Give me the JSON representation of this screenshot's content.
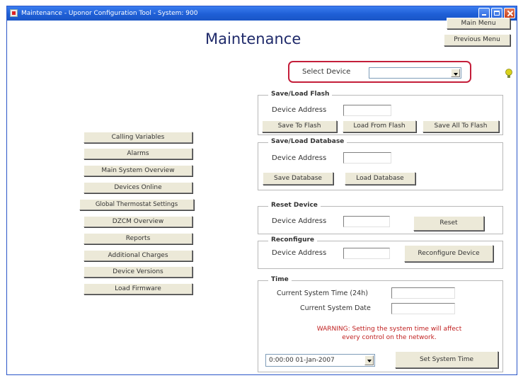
{
  "window": {
    "title": "Maintenance - Uponor Configuration Tool - System: 900"
  },
  "page_title": "Maintenance",
  "top_buttons": {
    "main_menu": "Main Menu",
    "previous_menu": "Previous Menu"
  },
  "select_device": {
    "label": "Select Device",
    "value": ""
  },
  "menu_items": [
    "Calling Variables",
    "Alarms",
    "Main System Overview",
    "Devices Online",
    "Global Thermostat Settings",
    "DZCM Overview",
    "Reports",
    "Additional Charges",
    "Device Versions",
    "Load Firmware"
  ],
  "save_load_flash": {
    "title": "Save/Load Flash",
    "address_label": "Device Address",
    "address_value": "",
    "buttons": [
      "Save To Flash",
      "Load From Flash",
      "Save All To Flash"
    ]
  },
  "save_load_database": {
    "title": "Save/Load Database",
    "address_label": "Device Address",
    "address_value": "",
    "buttons": [
      "Save Database",
      "Load Database"
    ]
  },
  "reset_device": {
    "title": "Reset Device",
    "address_label": "Device Address",
    "address_value": "",
    "button": "Reset"
  },
  "reconfigure": {
    "title": "Reconfigure",
    "address_label": "Device Address",
    "address_value": "",
    "button": "Reconfigure Device"
  },
  "time": {
    "title": "Time",
    "current_time_label": "Current System Time (24h)",
    "current_time_value": "",
    "current_date_label": "Current System Date",
    "current_date_value": "",
    "warning_line1": "WARNING: Setting the system time will affect",
    "warning_line2": "every control on the network.",
    "datetime_value": "0:00:00 01-Jan-2007",
    "set_button": "Set System Time"
  },
  "colors": {
    "highlight": "#c41e3a",
    "title_text": "#1f2a6a",
    "warning": "#c02020"
  }
}
